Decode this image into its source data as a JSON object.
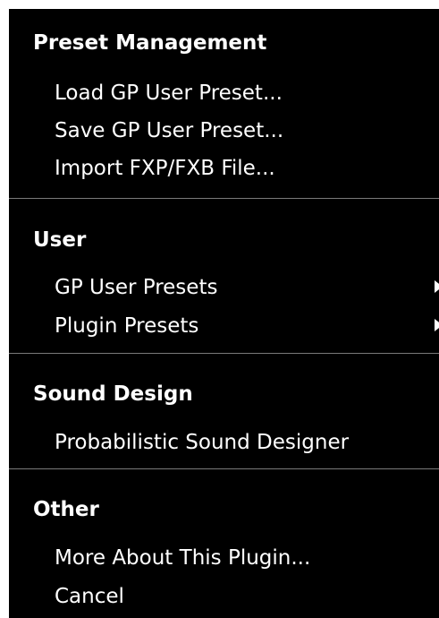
{
  "menu": {
    "sections": [
      {
        "header": "Preset Management",
        "items": [
          "Load GP User Preset...",
          "Save GP User Preset...",
          "Import FXP/FXB File..."
        ]
      },
      {
        "header": "User",
        "items": [
          "GP User Presets",
          "Plugin Presets"
        ]
      },
      {
        "header": "Sound Design",
        "items": [
          "Probabilistic Sound Designer"
        ]
      },
      {
        "header": "Other",
        "items": [
          "More About This Plugin...",
          "Cancel"
        ]
      }
    ],
    "submenu_indicator_icon": "triangle-right-icon",
    "colors": {
      "background": "#000000",
      "text": "#ffffff",
      "divider": "#7a7a7a"
    }
  }
}
